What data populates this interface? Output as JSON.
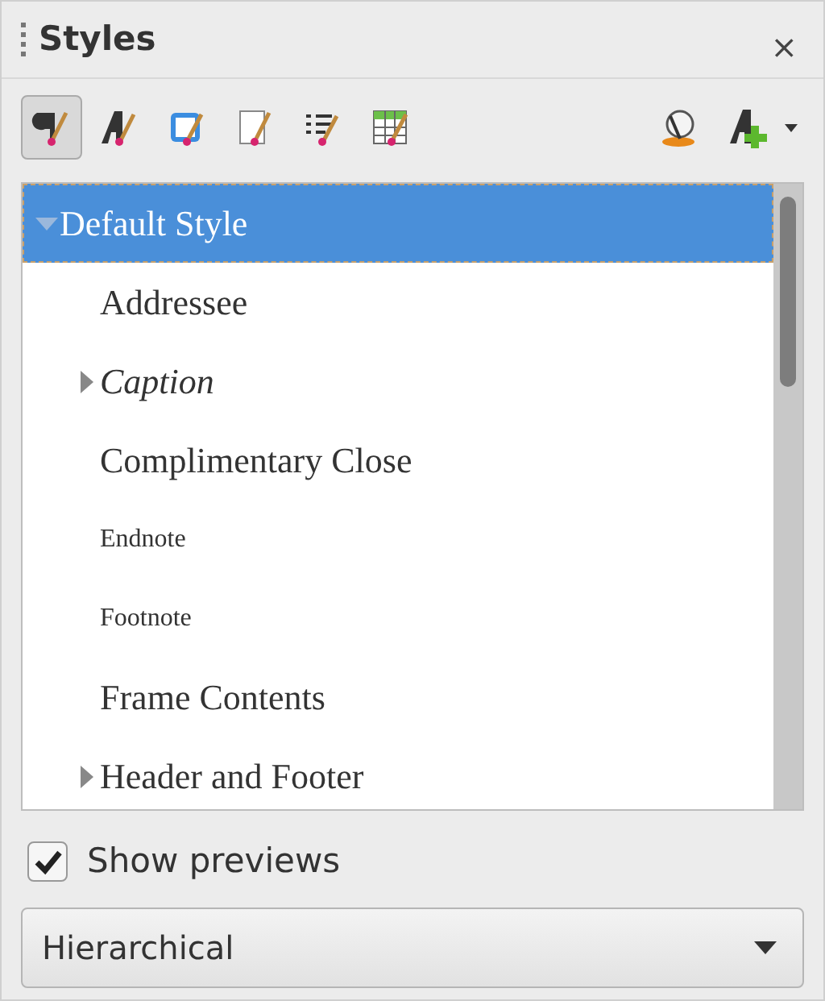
{
  "panel": {
    "title": "Styles",
    "close": "×"
  },
  "toolbar": {
    "families": [
      {
        "kind": "paragraph",
        "selected": true
      },
      {
        "kind": "character",
        "selected": false
      },
      {
        "kind": "frame",
        "selected": false
      },
      {
        "kind": "page",
        "selected": false
      },
      {
        "kind": "list",
        "selected": false
      },
      {
        "kind": "table",
        "selected": false
      }
    ]
  },
  "tree": [
    {
      "label": "Default Style",
      "kind": "normal",
      "selected": true,
      "expanded": true,
      "children": [
        {
          "label": "Addressee",
          "kind": "normal",
          "selected": false
        },
        {
          "label": "Caption",
          "kind": "italic",
          "selected": false,
          "expanded": false
        },
        {
          "label": "Complimentary Close",
          "kind": "normal",
          "selected": false
        },
        {
          "label": "Endnote",
          "kind": "small",
          "selected": false
        },
        {
          "label": "Footnote",
          "kind": "small",
          "selected": false
        },
        {
          "label": "Frame Contents",
          "kind": "normal",
          "selected": false
        },
        {
          "label": "Header and Footer",
          "kind": "normal",
          "selected": false,
          "expanded": false
        }
      ]
    }
  ],
  "show_previews": {
    "label": "Show previews",
    "checked": true
  },
  "filter": {
    "value": "Hierarchical"
  }
}
